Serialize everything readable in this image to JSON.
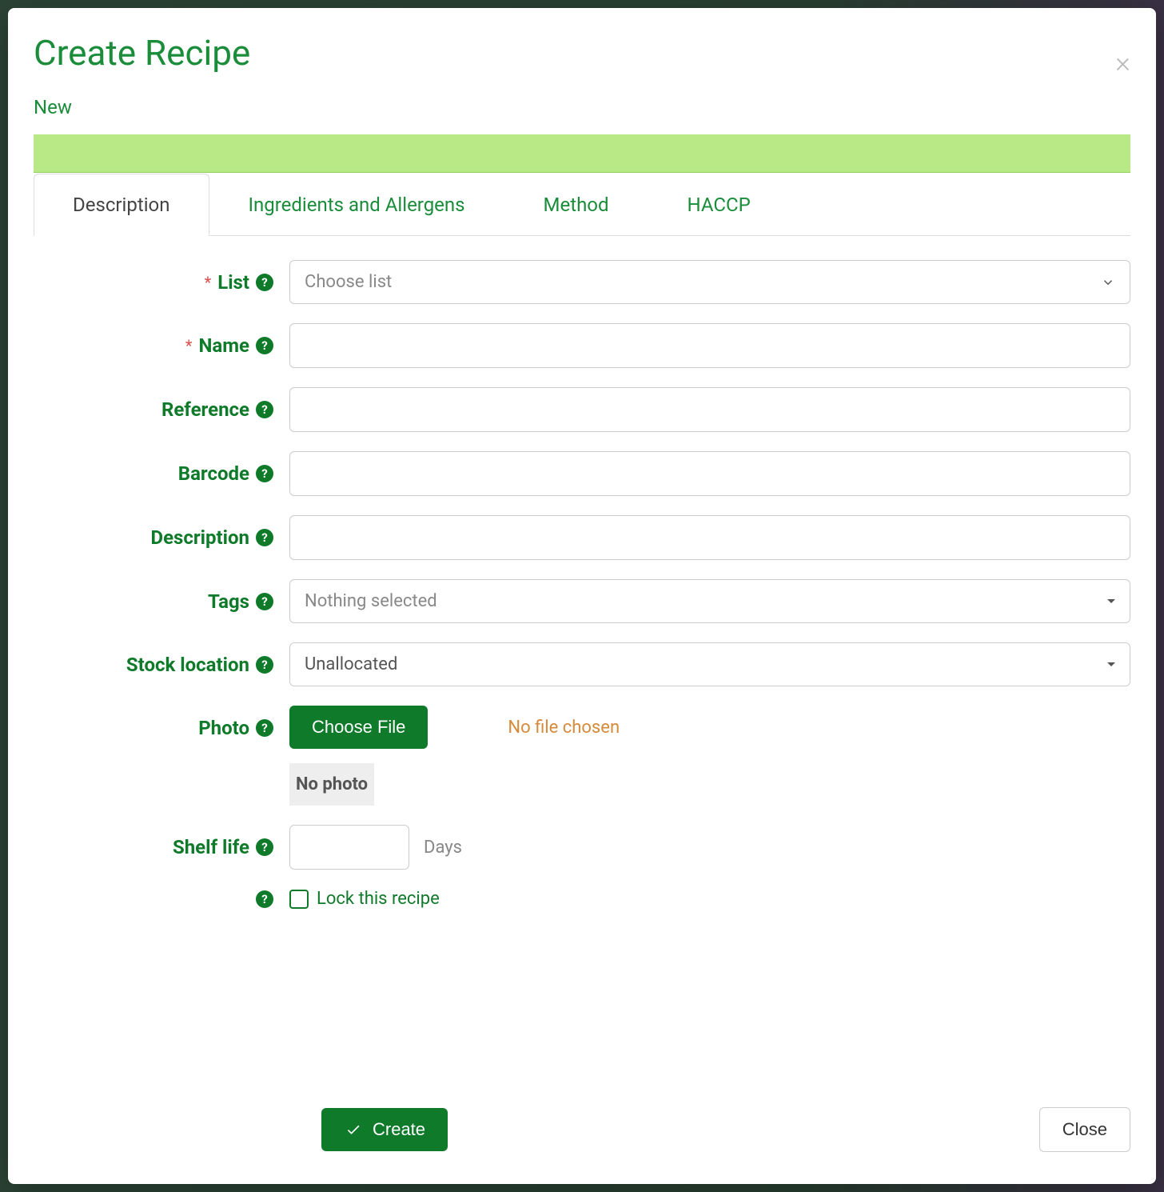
{
  "modal": {
    "title": "Create Recipe",
    "subtitle": "New"
  },
  "tabs": {
    "items": [
      {
        "label": "Description",
        "active": true
      },
      {
        "label": "Ingredients and Allergens",
        "active": false
      },
      {
        "label": "Method",
        "active": false
      },
      {
        "label": "HACCP",
        "active": false
      }
    ]
  },
  "form": {
    "list": {
      "label": "List",
      "placeholder": "Choose list",
      "required": true
    },
    "name": {
      "label": "Name",
      "value": "",
      "required": true
    },
    "reference": {
      "label": "Reference",
      "value": ""
    },
    "barcode": {
      "label": "Barcode",
      "value": ""
    },
    "description": {
      "label": "Description",
      "value": ""
    },
    "tags": {
      "label": "Tags",
      "placeholder": "Nothing selected"
    },
    "stock_location": {
      "label": "Stock location",
      "value": "Unallocated"
    },
    "photo": {
      "label": "Photo",
      "button": "Choose File",
      "status": "No file chosen",
      "preview": "No photo"
    },
    "shelf_life": {
      "label": "Shelf life",
      "value": "",
      "unit": "Days"
    },
    "lock": {
      "label": "Lock this recipe",
      "checked": false
    }
  },
  "buttons": {
    "create": "Create",
    "close": "Close"
  }
}
